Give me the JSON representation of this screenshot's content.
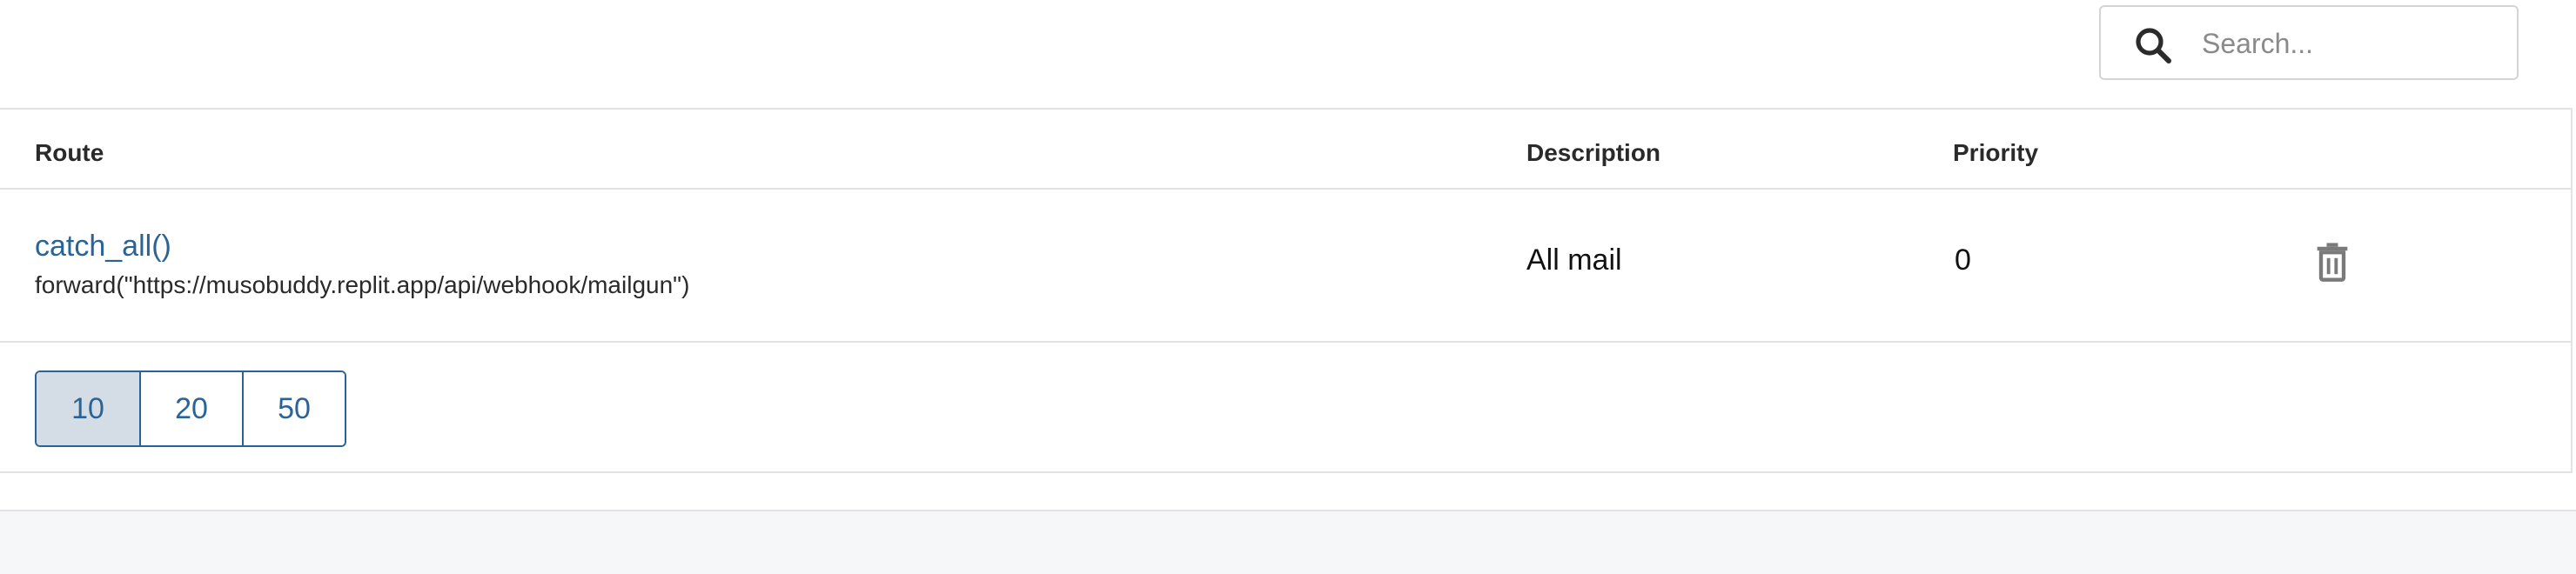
{
  "search": {
    "placeholder": "Search...",
    "value": ""
  },
  "table": {
    "columns": {
      "route": "Route",
      "description": "Description",
      "priority": "Priority"
    },
    "rows": [
      {
        "route_name": "catch_all()",
        "route_action": "forward(\"https://musobuddy.replit.app/api/webhook/mailgun\")",
        "description": "All mail",
        "priority": "0"
      }
    ]
  },
  "pagination": {
    "page_sizes": [
      "10",
      "20",
      "50"
    ],
    "selected": "10"
  },
  "icons": {
    "search": "search-icon",
    "delete": "trash-icon"
  },
  "colors": {
    "link": "#2a6496",
    "active_page_size_bg": "#d4dde5",
    "border": "#e2e2e2"
  }
}
